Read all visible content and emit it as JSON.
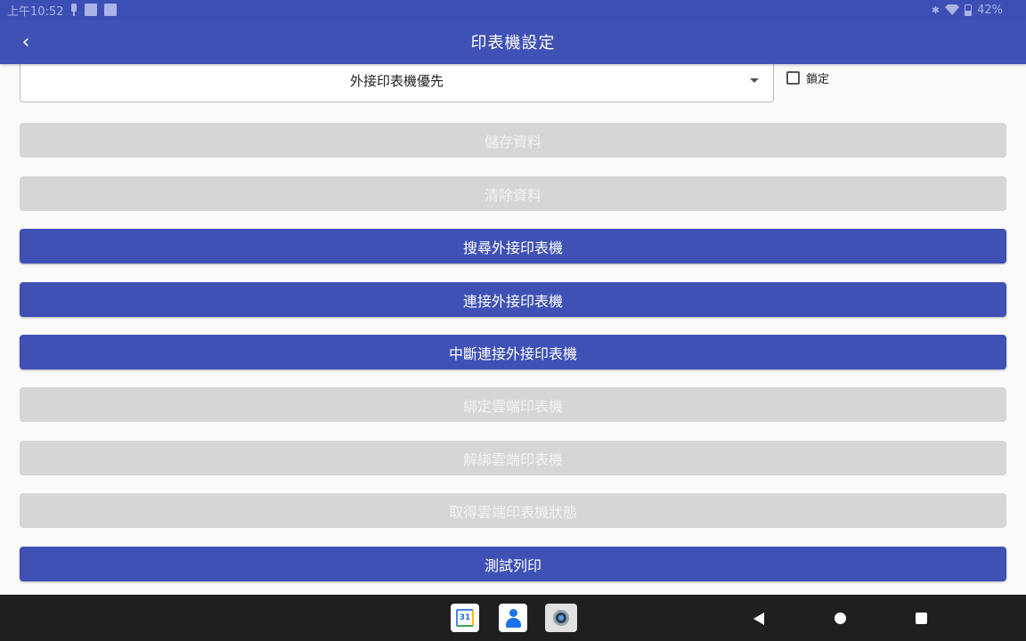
{
  "status_bar": {
    "time": "上午10:52",
    "battery": "42%"
  },
  "app_bar": {
    "back_icon": "chevron-left-icon",
    "back_glyph": "‹",
    "title": "印表機設定"
  },
  "printer_mode": {
    "selected": "外接印表機優先"
  },
  "lock_checkbox": {
    "label": "鎖定",
    "checked": false
  },
  "buttons": [
    {
      "label": "儲存資料",
      "enabled": false
    },
    {
      "label": "清除資料",
      "enabled": false
    },
    {
      "label": "搜尋外接印表機",
      "enabled": true
    },
    {
      "label": "連接外接印表機",
      "enabled": true
    },
    {
      "label": "中斷連接外接印表機",
      "enabled": true
    },
    {
      "label": "綁定雲端印表機",
      "enabled": false
    },
    {
      "label": "解綁雲端印表機",
      "enabled": false
    },
    {
      "label": "取得雲端印表機狀態",
      "enabled": false
    },
    {
      "label": "測試列印",
      "enabled": true
    }
  ],
  "nav_bar": {
    "calendar_day": "31"
  },
  "colors": {
    "primary": "#3f51b5",
    "disabled": "#d6d6d6",
    "status_bar": "#3c4fb4",
    "nav_bar": "#1f1f1f"
  }
}
